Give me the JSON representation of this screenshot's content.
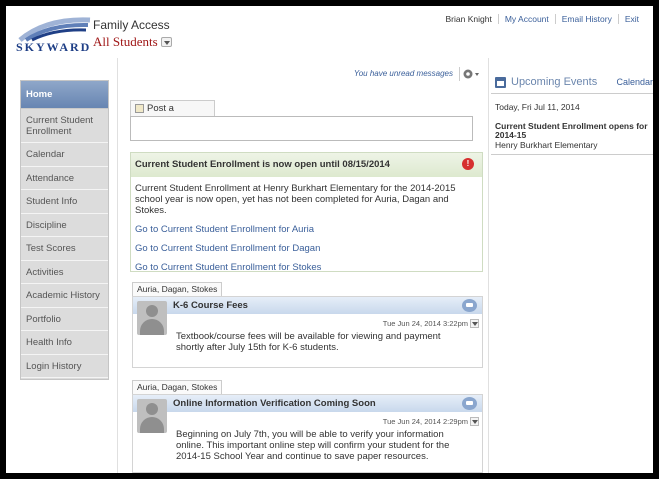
{
  "header": {
    "logo_text": "SKYWARD",
    "app_title": "Family Access",
    "student_selector": "All Students",
    "top_links": [
      "Brian Knight",
      "My Account",
      "Email History",
      "Exit"
    ]
  },
  "sidebar": {
    "items": [
      {
        "label": "Home"
      },
      {
        "label": "Current Student Enrollment"
      },
      {
        "label": "Calendar"
      },
      {
        "label": "Attendance"
      },
      {
        "label": "Student Info"
      },
      {
        "label": "Discipline"
      },
      {
        "label": "Test Scores"
      },
      {
        "label": "Activities"
      },
      {
        "label": "Academic History"
      },
      {
        "label": "Portfolio"
      },
      {
        "label": "Health Info"
      },
      {
        "label": "Login History"
      }
    ]
  },
  "main": {
    "unread_notice": "You have unread messages",
    "post_tab_label": "Post a message",
    "enrollment": {
      "title": "Current Student Enrollment is now open until 08/15/2014",
      "alert_glyph": "!",
      "message": "Current Student Enrollment at Henry Burkhart Elementary for the 2014-2015 school year is now open, yet has not been completed for Auria, Dagan and Stokes.",
      "links": [
        "Go to Current Student Enrollment for Auria",
        "Go to Current Student Enrollment for Dagan",
        "Go to Current Student Enrollment for Stokes"
      ]
    },
    "messages": [
      {
        "students": "Auria, Dagan, Stokes",
        "title": "K-6 Course Fees",
        "date": "Tue Jun 24, 2014 3:22pm",
        "body": "Textbook/course fees will be available for viewing and payment shortly after July 15th for K-6 students."
      },
      {
        "students": "Auria, Dagan, Stokes",
        "title": "Online Information Verification Coming Soon",
        "date": "Tue Jun 24, 2014 2:29pm",
        "body": "Beginning on July 7th, you will be able to verify your information online. This important online step will confirm your student for the 2014-15 School Year and continue to save paper resources."
      }
    ]
  },
  "events": {
    "title": "Upcoming Events",
    "calendar_link": "Calendar",
    "date": "Today, Fri Jul 11, 2014",
    "event_title": "Current Student Enrollment opens for 2014-15",
    "event_school": "Henry Burkhart Elementary"
  }
}
